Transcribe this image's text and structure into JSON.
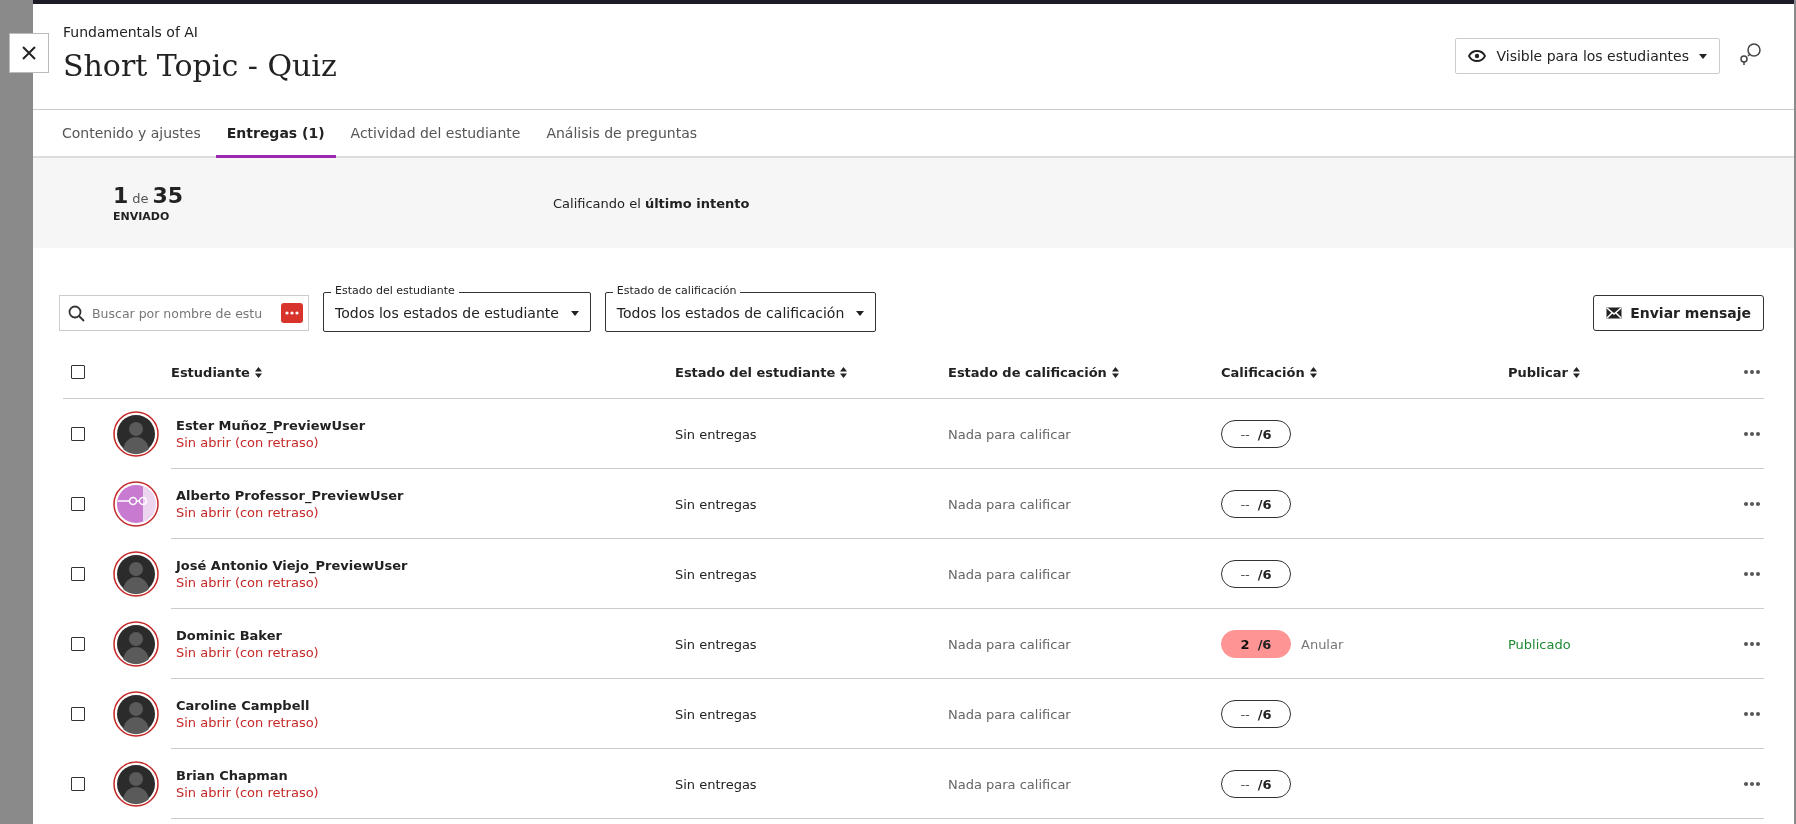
{
  "header": {
    "course": "Fundamentals of AI",
    "title": "Short Topic - Quiz",
    "visibility": "Visible para los estudiantes"
  },
  "tabs": [
    {
      "label": "Contenido y ajustes",
      "selected": false
    },
    {
      "label": "Entregas (1)",
      "selected": true
    },
    {
      "label": "Actividad del estudiante",
      "selected": false
    },
    {
      "label": "Análisis de preguntas",
      "selected": false
    }
  ],
  "summary": {
    "count": "1",
    "of": "de",
    "total": "35",
    "label": "ENVIADO",
    "grading": "Calificando el **último intento**"
  },
  "search": {
    "placeholder": "Buscar por nombre de estu"
  },
  "filters": [
    {
      "label": "Estado del estudiante",
      "value": "Todos los estados de estudiante"
    },
    {
      "label": "Estado de calificación",
      "value": "Todos los estados de calificación"
    }
  ],
  "message_button": "Enviar mensaje",
  "table": {
    "all_selected": false,
    "columns": [
      "Estudiante",
      "Estado del estudiante",
      "Estado de calificación",
      "Calificación",
      "Publicar"
    ],
    "rows": [
      {
        "checked": false,
        "avatar": {
          "kind": "silhouette"
        },
        "name": "Ester Muñoz_PreviewUser",
        "status": "Sin abrir (con retraso)",
        "student_state": "Sin entregas",
        "grading_state": "Nada para calificar",
        "grade": "--",
        "max": "/6",
        "graded": false
      },
      {
        "checked": false,
        "avatar": {
          "kind": "illustration"
        },
        "name": "Alberto Professor_PreviewUser",
        "status": "Sin abrir (con retraso)",
        "student_state": "Sin entregas",
        "grading_state": "Nada para calificar",
        "grade": "--",
        "max": "/6",
        "graded": false
      },
      {
        "checked": false,
        "avatar": {
          "kind": "silhouette"
        },
        "name": "José Antonio Viejo_PreviewUser",
        "status": "Sin abrir (con retraso)",
        "student_state": "Sin entregas",
        "grading_state": "Nada para calificar",
        "grade": "--",
        "max": "/6",
        "graded": false
      },
      {
        "checked": false,
        "avatar": {
          "kind": "silhouette"
        },
        "name": "Dominic Baker",
        "status": "Sin abrir (con retraso)",
        "student_state": "Sin entregas",
        "grading_state": "Nada para calificar",
        "grade": "2",
        "max": "/6",
        "graded": true,
        "override": "Anular",
        "publish": "Publicado"
      },
      {
        "checked": false,
        "avatar": {
          "kind": "silhouette"
        },
        "name": "Caroline Campbell",
        "status": "Sin abrir (con retraso)",
        "student_state": "Sin entregas",
        "grading_state": "Nada para calificar",
        "grade": "--",
        "max": "/6",
        "graded": false
      },
      {
        "checked": false,
        "avatar": {
          "kind": "silhouette"
        },
        "name": "Brian Chapman",
        "status": "Sin abrir (con retraso)",
        "student_state": "Sin entregas",
        "grading_state": "Nada para calificar",
        "grade": "--",
        "max": "/6",
        "graded": false
      }
    ]
  }
}
